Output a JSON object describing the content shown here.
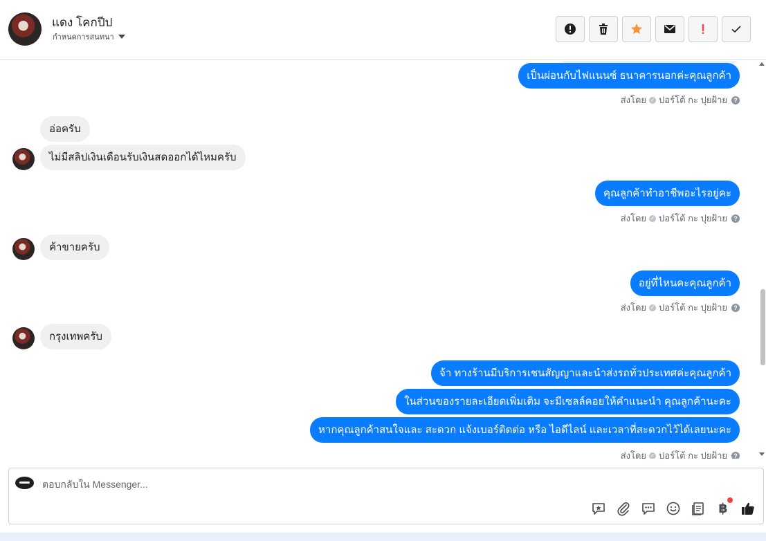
{
  "header": {
    "contact_name": "แดง โคกปีป",
    "assign_label": "กำหนดการสนทนา",
    "actions": [
      {
        "name": "mark-spam",
        "icon": "alert-circle-icon"
      },
      {
        "name": "delete",
        "icon": "trash-icon"
      },
      {
        "name": "star",
        "icon": "star-icon"
      },
      {
        "name": "mark-unread",
        "icon": "envelope-icon"
      },
      {
        "name": "follow-up",
        "icon": "exclamation-icon"
      },
      {
        "name": "mark-done",
        "icon": "checkmark-icon"
      }
    ]
  },
  "colors": {
    "outgoing_bubble": "#0a7cff",
    "incoming_bubble": "#f0f0f0",
    "star": "#f7923b",
    "follow_up": "#fa3e3e"
  },
  "messages": {
    "out_1": "เป็นผ่อนกับไฟแนนซ์ ธนาคารนอกค่ะคุณลูกค้า",
    "in_1": "อ่อครับ",
    "in_2": "ไม่มีสลิปเงินเดือนรับเงินสดออกได้ไหมครับ",
    "out_2": "คุณลูกค้าทำอาชีพอะไรอยู่คะ",
    "in_3": "ค้าขายครับ",
    "out_3": "อยู่ที่ไหนคะคุณลูกค้า",
    "in_4": "กรุงเทพครับ",
    "out_4": "จ้า ทางร้านมีบริการเชนสัญญาและนำส่งรถทั่วประเทศค่ะคุณลูกค้า",
    "out_5": "ในส่วนของรายละเอียดเพิ่มเติม จะมีเซลล์คอยให้คำแนะนำ คุณลูกค้านะคะ",
    "out_6": "หากคุณลูกค้าสนใจและ สะดวก แจ้งเบอร์ติดต่อ หรือ ไอดีไลน์ และเวลาที่สะดวกไว้ได้เลยนะคะ"
  },
  "sent_meta": {
    "sent_by_label": "ส่งโดย",
    "sender_name": "ปอร์โต้ กะ ปุยฝ้าย",
    "help_glyph": "?"
  },
  "composer": {
    "placeholder": "ตอบกลับใน Messenger...",
    "tools": [
      "saved-reply-icon",
      "attachment-icon",
      "chat-bubbles-icon",
      "emoji-icon",
      "catalog-icon",
      "payment-icon",
      "thumbs-up-icon"
    ],
    "payment_glyph": "฿"
  }
}
